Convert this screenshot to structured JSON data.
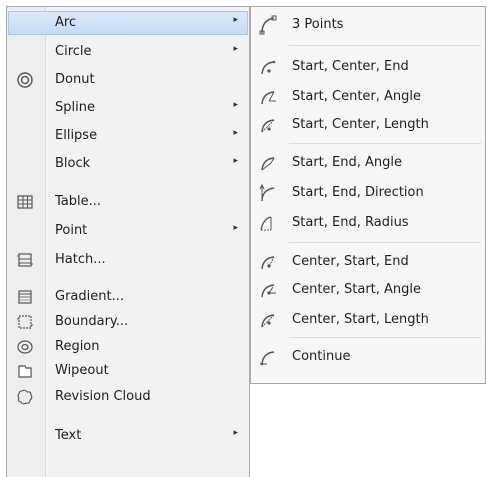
{
  "draw_menu": {
    "items": [
      {
        "label": "Arc",
        "icon": "none",
        "submenu": true,
        "active": true
      },
      {
        "label": "Circle",
        "icon": "none",
        "submenu": true
      },
      {
        "label": "Donut",
        "icon": "donut-icon",
        "submenu": false
      },
      {
        "label": "Spline",
        "icon": "none",
        "submenu": true
      },
      {
        "label": "Ellipse",
        "icon": "none",
        "submenu": true
      },
      {
        "label": "Block",
        "icon": "none",
        "submenu": true
      },
      {
        "label": "Table...",
        "icon": "table-icon",
        "submenu": false
      },
      {
        "label": "Point",
        "icon": "none",
        "submenu": true
      },
      {
        "label": "Hatch...",
        "icon": "hatch-icon",
        "submenu": false
      },
      {
        "label": "Gradient...",
        "icon": "gradient-icon",
        "submenu": false
      },
      {
        "label": "Boundary...",
        "icon": "boundary-icon",
        "submenu": false
      },
      {
        "label": "Region",
        "icon": "region-icon",
        "submenu": false
      },
      {
        "label": "Wipeout",
        "icon": "wipeout-icon",
        "submenu": false
      },
      {
        "label": "Revision Cloud",
        "icon": "revision-cloud-icon",
        "submenu": false
      },
      {
        "label": "Text",
        "icon": "none",
        "submenu": true
      }
    ],
    "submenu_arrow": "▸"
  },
  "arc_submenu": {
    "items": [
      {
        "label": "3 Points",
        "icon": "arc-3points-icon"
      },
      {
        "label": "Start, Center, End",
        "icon": "arc-start-center-end-icon"
      },
      {
        "label": "Start, Center, Angle",
        "icon": "arc-start-center-angle-icon"
      },
      {
        "label": "Start, Center, Length",
        "icon": "arc-start-center-length-icon"
      },
      {
        "label": "Start, End, Angle",
        "icon": "arc-start-end-angle-icon"
      },
      {
        "label": "Start, End, Direction",
        "icon": "arc-start-end-direction-icon"
      },
      {
        "label": "Start, End, Radius",
        "icon": "arc-start-end-radius-icon"
      },
      {
        "label": "Center, Start, End",
        "icon": "arc-center-start-end-icon"
      },
      {
        "label": "Center, Start, Angle",
        "icon": "arc-center-start-angle-icon"
      },
      {
        "label": "Center, Start, Length",
        "icon": "arc-center-start-length-icon"
      },
      {
        "label": "Continue",
        "icon": "arc-continue-icon"
      }
    ]
  },
  "colors": {
    "highlight": "#c5dbf5",
    "menu_bg": "#f3f3f3",
    "icon_stroke": "#555555"
  }
}
